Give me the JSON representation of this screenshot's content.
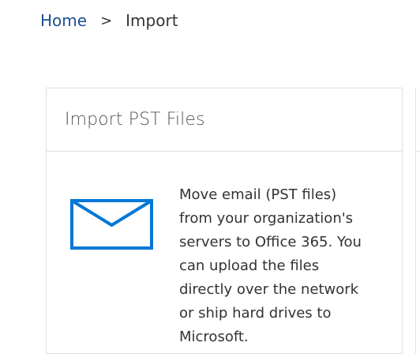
{
  "breadcrumb": {
    "home_label": "Home",
    "separator": ">",
    "current_label": "Import"
  },
  "card": {
    "title": "Import PST Files",
    "icon": "mail-envelope-icon",
    "description": "Move email (PST files) from your organization's servers to Office 365. You can upload the files directly over the network or ship hard drives to Microsoft."
  },
  "colors": {
    "link": "#1d4f91",
    "icon_blue": "#0078d7",
    "border": "#e1e1e1",
    "text": "#333333"
  }
}
